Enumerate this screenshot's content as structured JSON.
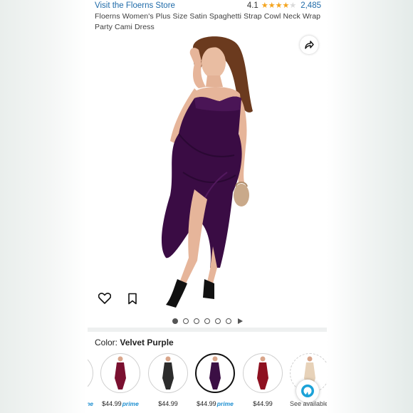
{
  "header": {
    "store_link": "Visit the Floerns Store",
    "rating_value": "4.1",
    "review_count": "2,485",
    "star_rating": 4.1,
    "title": "Floerns Women's Plus Size Satin Spaghetti Strap Cowl Neck Wrap Party Cami Dress"
  },
  "gallery": {
    "image_count": 6,
    "active_index": 0,
    "icons": [
      "share-icon",
      "heart-icon",
      "bookmark-icon",
      "play-icon"
    ]
  },
  "color_selector": {
    "label": "Color:",
    "selected_color": "Velvet Purple"
  },
  "swatches": [
    {
      "price": "",
      "prime": "ne",
      "color": "#5b1020"
    },
    {
      "price": "$44.99",
      "prime": "prime",
      "color": "#7a1030"
    },
    {
      "price": "$44.99",
      "prime": "",
      "color": "#2c2c2c"
    },
    {
      "price": "$44.99",
      "prime": "prime",
      "color": "#3b0f44"
    },
    {
      "price": "$44.99",
      "prime": "",
      "color": "#8e1020"
    },
    {
      "see_available": "See available options",
      "color": "#d7b48a"
    }
  ],
  "colors": {
    "link": "#1e6aa8",
    "star": "#f4a41d",
    "dress": "#3a0c44",
    "prime": "#1e8fd1",
    "alexa": "#1ba2d8"
  }
}
